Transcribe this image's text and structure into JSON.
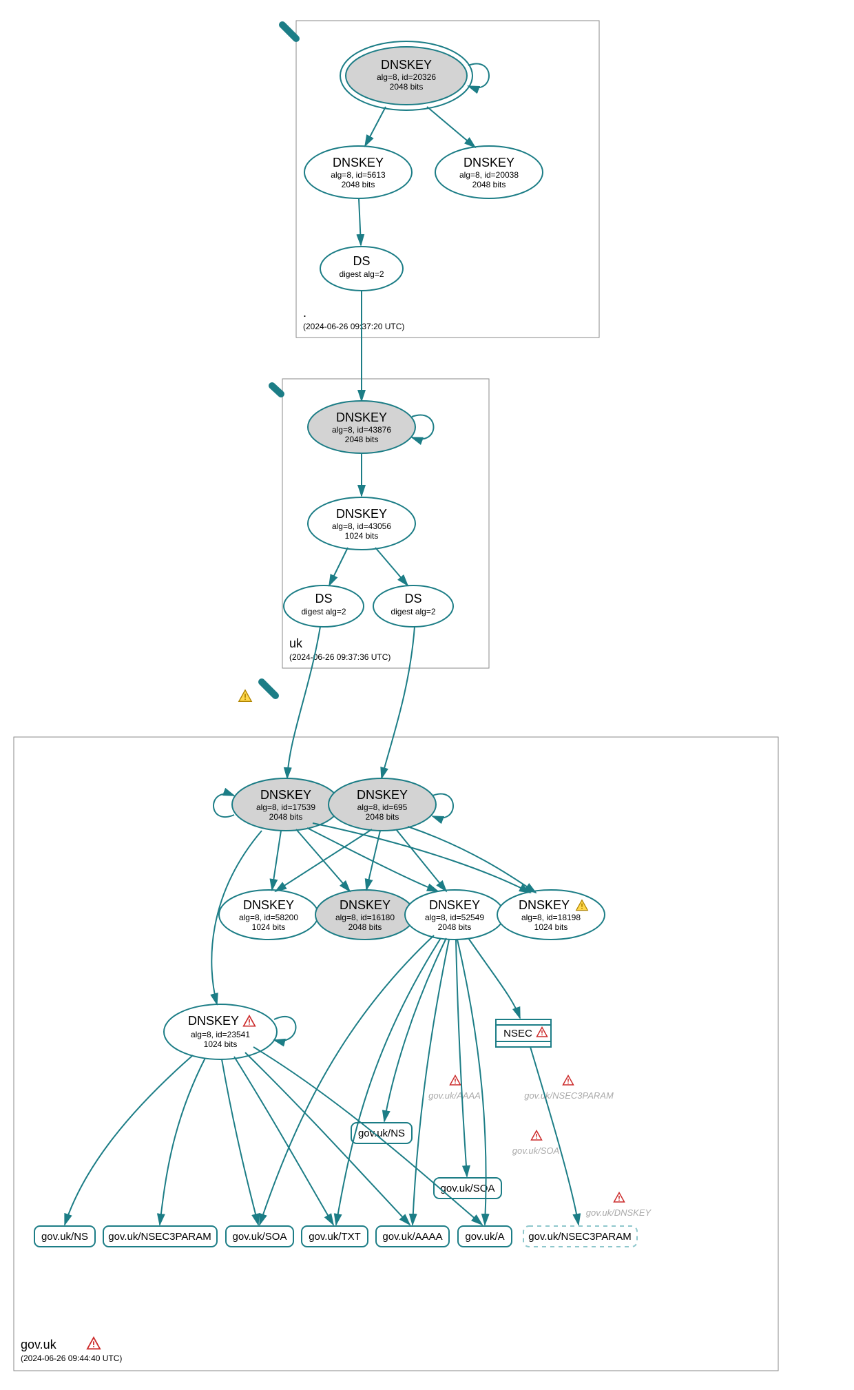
{
  "graph": {
    "zones": [
      {
        "name": ".",
        "ts": "(2024-06-26 09:37:20 UTC)"
      },
      {
        "name": "uk",
        "ts": "(2024-06-26 09:37:36 UTC)"
      },
      {
        "name": "gov.uk",
        "ts": "(2024-06-26 09:44:40 UTC)"
      }
    ],
    "nodes": {
      "root_ksk": {
        "title": "DNSKEY",
        "lines": [
          "alg=8, id=20326",
          "2048 bits"
        ]
      },
      "root_zsk1": {
        "title": "DNSKEY",
        "lines": [
          "alg=8, id=5613",
          "2048 bits"
        ]
      },
      "root_zsk2": {
        "title": "DNSKEY",
        "lines": [
          "alg=8, id=20038",
          "2048 bits"
        ]
      },
      "root_ds": {
        "title": "DS",
        "lines": [
          "digest alg=2"
        ]
      },
      "uk_ksk": {
        "title": "DNSKEY",
        "lines": [
          "alg=8, id=43876",
          "2048 bits"
        ]
      },
      "uk_zsk": {
        "title": "DNSKEY",
        "lines": [
          "alg=8, id=43056",
          "1024 bits"
        ]
      },
      "uk_ds1": {
        "title": "DS",
        "lines": [
          "digest alg=2"
        ]
      },
      "uk_ds2": {
        "title": "DS",
        "lines": [
          "digest alg=2"
        ]
      },
      "gov_ksk1": {
        "title": "DNSKEY",
        "lines": [
          "alg=8, id=17539",
          "2048 bits"
        ]
      },
      "gov_ksk2": {
        "title": "DNSKEY",
        "lines": [
          "alg=8, id=695",
          "2048 bits"
        ]
      },
      "gov_58200": {
        "title": "DNSKEY",
        "lines": [
          "alg=8, id=58200",
          "1024 bits"
        ]
      },
      "gov_16180": {
        "title": "DNSKEY",
        "lines": [
          "alg=8, id=16180",
          "2048 bits"
        ]
      },
      "gov_52549": {
        "title": "DNSKEY",
        "lines": [
          "alg=8, id=52549",
          "2048 bits"
        ]
      },
      "gov_18198": {
        "title": "DNSKEY",
        "lines": [
          "alg=8, id=18198",
          "1024 bits"
        ]
      },
      "gov_23541": {
        "title": "DNSKEY",
        "lines": [
          "alg=8, id=23541",
          "1024 bits"
        ]
      },
      "gov_nsec": {
        "title": "NSEC",
        "lines": []
      }
    },
    "rr": {
      "r_ns1": "gov.uk/NS",
      "r_n3p1": "gov.uk/NSEC3PARAM",
      "r_soa1": "gov.uk/SOA",
      "r_txt": "gov.uk/TXT",
      "r_aaaa1": "gov.uk/AAAA",
      "r_a": "gov.uk/A",
      "r_ns2": "gov.uk/NS",
      "r_soa2": "gov.uk/SOA",
      "r_n3p2": "gov.uk/NSEC3PARAM"
    },
    "ghost": {
      "g_aaaa": "gov.uk/AAAA",
      "g_n3p": "gov.uk/NSEC3PARAM",
      "g_soa": "gov.uk/SOA",
      "g_dnskey": "gov.uk/DNSKEY"
    }
  }
}
